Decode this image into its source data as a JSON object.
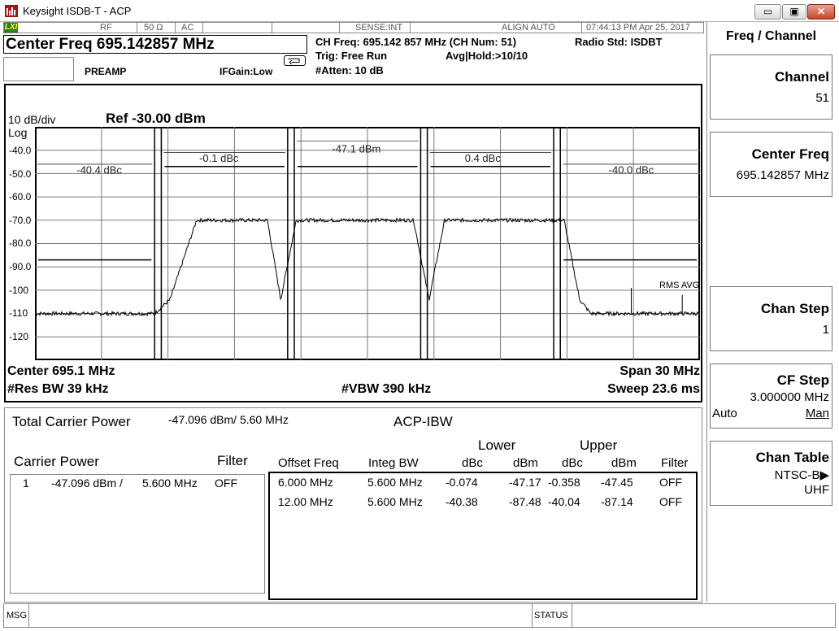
{
  "window": {
    "title": "Keysight ISDB-T - ACP",
    "min": "▭",
    "max": "▣",
    "close": "✕"
  },
  "status_row": {
    "lxi": "LXI",
    "rf": "RF",
    "impedance": "50 Ω",
    "coupling": "AC",
    "sense": "SENSE:INT",
    "align": "ALIGN AUTO",
    "datetime": "07:44:13 PM Apr 25, 2017"
  },
  "header": {
    "center_freq": "Center Freq 695.142857 MHz",
    "preamp": "PREAMP",
    "ifgain": "IFGain:Low",
    "ch_freq": "CH Freq: 695.142 857 MHz (CH Num: 51)",
    "trig": "Trig: Free Run",
    "avg_hold": "Avg|Hold:>10/10",
    "atten": "#Atten: 10 dB",
    "radio_std": "Radio Std: ISDBT"
  },
  "graticule": {
    "scale": "10 dB/div",
    "ref": "Ref -30.00 dBm",
    "log": "Log",
    "y_ticks": [
      "-40.0",
      "-50.0",
      "-60.0",
      "-70.0",
      "-80.0",
      "-90.0",
      "-100",
      "-110",
      "-120"
    ],
    "channel_labels": [
      "-40.4 dBc",
      "-0.1 dBc",
      "-47.1 dBm",
      "0.4 dBc",
      "-40.0 dBc"
    ],
    "detector": "RMS AVG",
    "center": "Center  695.1 MHz",
    "span": "Span 30 MHz",
    "res_bw": "#Res BW  39 kHz",
    "vbw": "#VBW  390 kHz",
    "sweep": "Sweep  23.6 ms"
  },
  "chart_data": {
    "type": "line",
    "x_range_mhz": [
      680.1,
      710.1
    ],
    "ylim": [
      -130,
      -30
    ],
    "y_unit": "dBm",
    "y_per_div": 10,
    "series": [
      {
        "x_mhz": [
          680.1,
          685.5,
          686.2,
          687.4,
          690.6,
          691.2,
          691.9,
          697.2,
          697.9,
          698.6,
          704.0,
          704.7,
          705.2,
          710.1
        ],
        "y_dbm": [
          -110,
          -110,
          -104,
          -70,
          -70,
          -104,
          -70,
          -70,
          -104,
          -70,
          -70,
          -104,
          -110,
          -110
        ]
      }
    ]
  },
  "results": {
    "total_carrier_power_label": "Total Carrier Power",
    "total_carrier_power_value": "-47.096 dBm/ 5.60 MHz",
    "mode": "ACP-IBW",
    "carrier_power_label": "Carrier Power",
    "filter_label": "Filter",
    "carrier_rows": [
      {
        "num": "1",
        "power": "-47.096 dBm /",
        "bw": "5.600 MHz",
        "filter": "OFF"
      }
    ],
    "lower": "Lower",
    "upper": "Upper",
    "columns": [
      "Offset Freq",
      "Integ BW",
      "dBc",
      "dBm",
      "dBc",
      "dBm",
      "Filter"
    ],
    "offset_rows": [
      {
        "offset": "6.000 MHz",
        "integ": "5.600 MHz",
        "l_dbc": "-0.074",
        "l_dbm": "-47.17",
        "u_dbc": "-0.358",
        "u_dbm": "-47.45",
        "filter": "OFF"
      },
      {
        "offset": "12.00 MHz",
        "integ": "5.600 MHz",
        "l_dbc": "-40.38",
        "l_dbm": "-87.48",
        "u_dbc": "-40.04",
        "u_dbm": "-87.14",
        "filter": "OFF"
      }
    ]
  },
  "softkeys": {
    "menu_title": "Freq / Channel",
    "channel": {
      "label": "Channel",
      "value": "51"
    },
    "center_freq": {
      "label": "Center Freq",
      "value": "695.142857 MHz"
    },
    "chan_step": {
      "label": "Chan Step",
      "value": "1"
    },
    "cf_step": {
      "label": "CF Step",
      "value": "3.000000 MHz",
      "auto": "Auto",
      "man": "Man"
    },
    "chan_table": {
      "label": "Chan Table",
      "value": "NTSC-B▶",
      "value2": "UHF"
    }
  },
  "bottom": {
    "msg": "MSG",
    "status": "STATUS"
  }
}
